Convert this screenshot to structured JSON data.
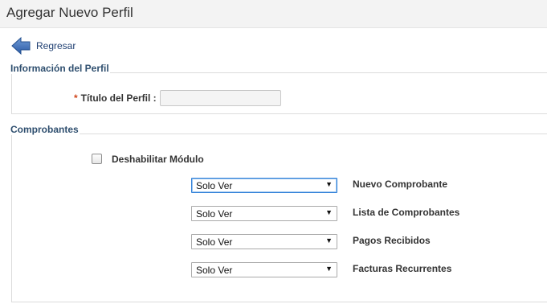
{
  "header": {
    "title": "Agregar Nuevo Perfil"
  },
  "back": {
    "label": "Regresar"
  },
  "profile_section": {
    "legend": "Información del Perfil",
    "title_field": {
      "required_mark": "*",
      "label": "Título del Perfil :",
      "value": ""
    }
  },
  "receipts_section": {
    "legend": "Comprobantes",
    "disable_module": {
      "label": "Deshabilitar Módulo",
      "checked": false
    },
    "permissions": [
      {
        "value": "Solo Ver",
        "label": "Nuevo Comprobante"
      },
      {
        "value": "Solo Ver",
        "label": "Lista de Comprobantes"
      },
      {
        "value": "Solo Ver",
        "label": "Pagos Recibidos"
      },
      {
        "value": "Solo Ver",
        "label": "Facturas Recurrentes"
      }
    ],
    "dropdown_arrow": "▼"
  },
  "colors": {
    "header_bg": "#f3f3f3",
    "link": "#1f3f72",
    "legend": "#2f4f6f",
    "required": "#d0451b",
    "focus": "#2f7fd8"
  },
  "icons": {
    "back": "back-arrow-icon",
    "dropdown": "chevron-down-icon"
  }
}
